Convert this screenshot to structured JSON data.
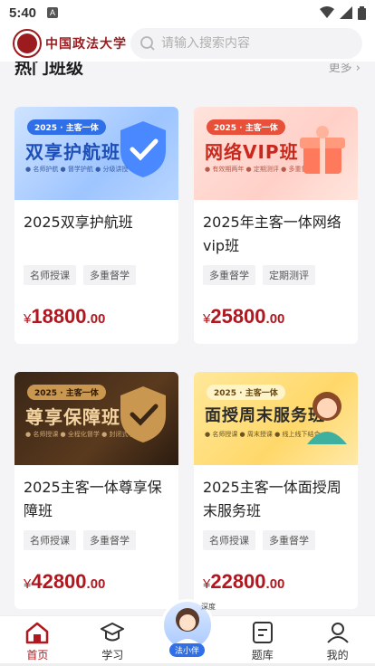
{
  "statusbar": {
    "time": "5:40",
    "sim_label": "A"
  },
  "header": {
    "logo_text": "中国政法大学",
    "search_placeholder": "请输入搜索内容"
  },
  "section": {
    "title": "热门班级",
    "more": "更多"
  },
  "courses": [
    {
      "banner_chip": "2025 · 主客一体",
      "banner_title": "双享护航班",
      "banner_sub": "● 名师护航  ● 督学护航  ● 分级讲授",
      "title": "2025双享护航班",
      "tags": [
        "名师授课",
        "多重督学"
      ],
      "price_symbol": "¥",
      "price_int": "18800",
      "price_dec": ".00"
    },
    {
      "banner_chip": "2025 · 主客一体",
      "banner_title": "网络VIP班",
      "banner_sub": "● 有效期两年  ● 定期测评  ● 多重督学",
      "title": "2025年主客一体网络vip班",
      "tags": [
        "多重督学",
        "定期测评"
      ],
      "price_symbol": "¥",
      "price_int": "25800",
      "price_dec": ".00"
    },
    {
      "banner_chip": "2025 · 主客一体",
      "banner_title": "尊享保障班",
      "banner_sub": "● 名师授课  ● 全程化督学  ● 封闭式学习",
      "title": "2025主客一体尊享保障班",
      "tags": [
        "名师授课",
        "多重督学"
      ],
      "price_symbol": "¥",
      "price_int": "42800",
      "price_dec": ".00"
    },
    {
      "banner_chip": "2025 · 主客一体",
      "banner_title": "面授周末服务班",
      "banner_sub": "● 名师授课  ● 周末授课  ● 线上线下结合",
      "title": "2025主客一体面授周末服务班",
      "tags": [
        "名师授课",
        "多重督学"
      ],
      "price_symbol": "¥",
      "price_int": "22800",
      "price_dec": ".00"
    }
  ],
  "assistant": {
    "label": "法小伴",
    "tag": "深度"
  },
  "nav": [
    {
      "label": "首页",
      "icon": "home-icon",
      "active": true
    },
    {
      "label": "学习",
      "icon": "graduation-cap-icon",
      "active": false
    },
    {
      "label": "题库",
      "icon": "question-bank-icon",
      "active": false
    },
    {
      "label": "我的",
      "icon": "profile-icon",
      "active": false
    }
  ],
  "colors": {
    "brand": "#b0171f",
    "logo": "#9b1b1e",
    "assistant": "#2f6fe8"
  }
}
